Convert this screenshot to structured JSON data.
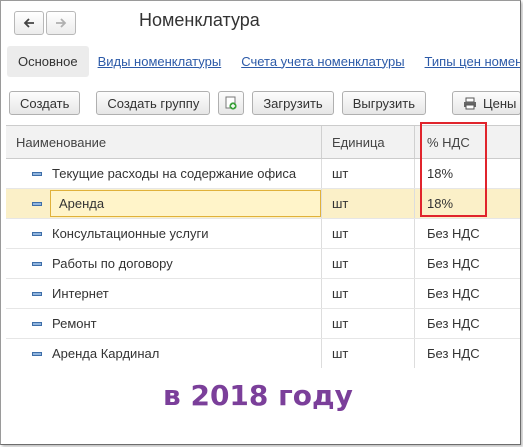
{
  "window": {
    "title": "Номенклатура"
  },
  "nav": {
    "back": "arrow-left-icon",
    "forward": "arrow-right-icon"
  },
  "tabs": [
    {
      "label": "Основное",
      "active": true
    },
    {
      "label": "Виды номенклатуры",
      "active": false
    },
    {
      "label": "Счета учета номенклатуры",
      "active": false
    },
    {
      "label": "Типы цен номенклатуры",
      "active": false
    }
  ],
  "toolbar": {
    "create": "Создать",
    "create_group": "Создать группу",
    "load": "Загрузить",
    "unload": "Выгрузить",
    "print": "Цены"
  },
  "table": {
    "headers": {
      "name": "Наименование",
      "unit": "Единица",
      "vat": "% НДС"
    },
    "rows": [
      {
        "name": "Текущие расходы на содержание офиса",
        "unit": "шт",
        "vat": "18%"
      },
      {
        "name": "Аренда",
        "unit": "шт",
        "vat": "18%",
        "selected": true
      },
      {
        "name": "Консультационные услуги",
        "unit": "шт",
        "vat": "Без НДС"
      },
      {
        "name": "Работы по договору",
        "unit": "шт",
        "vat": "Без НДС"
      },
      {
        "name": "Интернет",
        "unit": "шт",
        "vat": "Без НДС"
      },
      {
        "name": "Ремонт",
        "unit": "шт",
        "vat": "Без НДС"
      },
      {
        "name": "Аренда Кардинал",
        "unit": "шт",
        "vat": "Без НДС"
      }
    ]
  },
  "caption": "в 2018 году",
  "colors": {
    "link": "#2c5aa8",
    "highlight": "#e0242c",
    "caption": "#7b3f9a",
    "selected_row": "#fbf0c8"
  }
}
